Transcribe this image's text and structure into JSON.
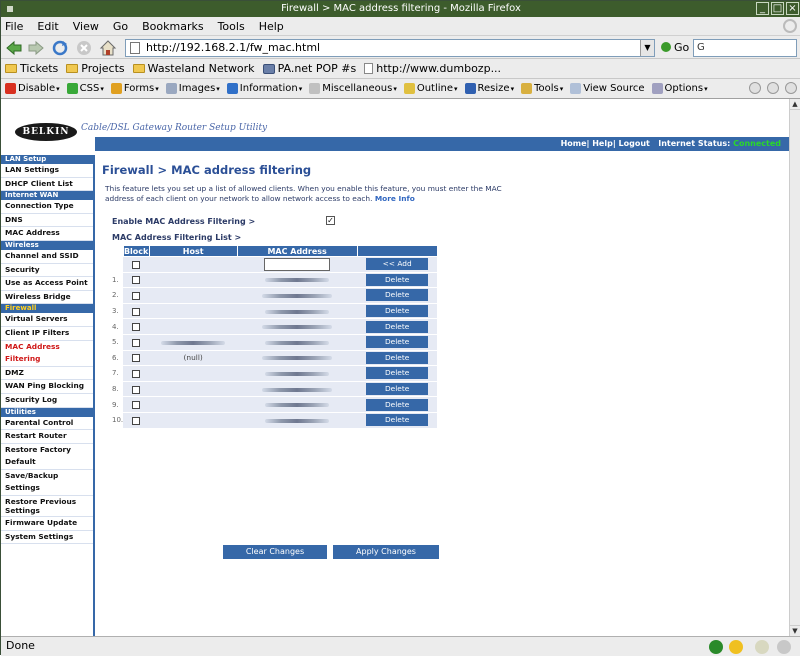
{
  "window": {
    "title": "Firewall > MAC address filtering - Mozilla Firefox"
  },
  "menu": {
    "file": "File",
    "edit": "Edit",
    "view": "View",
    "go": "Go",
    "bookmarks": "Bookmarks",
    "tools": "Tools",
    "help": "Help"
  },
  "toolbar": {
    "url": "http://192.168.2.1/fw_mac.html",
    "go_label": "Go",
    "search_value": "G"
  },
  "bookmarks": [
    {
      "label": "Tickets",
      "icon": "folder-icon"
    },
    {
      "label": "Projects",
      "icon": "folder-icon"
    },
    {
      "label": "Wasteland Network",
      "icon": "folder-icon"
    },
    {
      "label": "PA.net POP #s",
      "icon": "bookmark-icon"
    },
    {
      "label": "http://www.dumbozp...",
      "icon": "page-icon"
    }
  ],
  "devbar": [
    {
      "label": "Disable",
      "color": "#d83020"
    },
    {
      "label": "CSS",
      "color": "#38a838"
    },
    {
      "label": "Forms",
      "color": "#e0a020"
    },
    {
      "label": "Images",
      "color": "#9aa8c0"
    },
    {
      "label": "Information",
      "color": "#3070c8"
    },
    {
      "label": "Miscellaneous",
      "color": "#c0c0c0"
    },
    {
      "label": "Outline",
      "color": "#e0c040"
    },
    {
      "label": "Resize",
      "color": "#3060b0"
    },
    {
      "label": "Tools",
      "color": "#d8b040"
    },
    {
      "label": "View Source",
      "color": "#b0c0d8"
    },
    {
      "label": "Options",
      "color": "#a0a0c0"
    }
  ],
  "router": {
    "logo": "BELKIN",
    "tagline": "Cable/DSL Gateway Router Setup Utility",
    "toplinks": "Home| Help| Logout",
    "status_label": "Internet Status:",
    "status_value": "Connected"
  },
  "nav": [
    {
      "type": "header",
      "label": "LAN Setup"
    },
    {
      "type": "item",
      "label": "LAN Settings"
    },
    {
      "type": "item",
      "label": "DHCP Client List"
    },
    {
      "type": "header",
      "label": "Internet WAN"
    },
    {
      "type": "item",
      "label": "Connection Type"
    },
    {
      "type": "item",
      "label": "DNS"
    },
    {
      "type": "item",
      "label": "MAC Address"
    },
    {
      "type": "header",
      "label": "Wireless"
    },
    {
      "type": "item",
      "label": "Channel and SSID"
    },
    {
      "type": "item",
      "label": "Security"
    },
    {
      "type": "item",
      "label": "Use as Access Point"
    },
    {
      "type": "item",
      "label": "Wireless Bridge"
    },
    {
      "type": "header",
      "label": "Firewall",
      "variant": "fw"
    },
    {
      "type": "item",
      "label": "Virtual Servers"
    },
    {
      "type": "item",
      "label": "Client IP Filters"
    },
    {
      "type": "item",
      "label": "MAC Address Filtering",
      "active": true
    },
    {
      "type": "item",
      "label": "DMZ"
    },
    {
      "type": "item",
      "label": "WAN Ping Blocking"
    },
    {
      "type": "item",
      "label": "Security Log"
    },
    {
      "type": "header",
      "label": "Utilities"
    },
    {
      "type": "item",
      "label": "Parental Control"
    },
    {
      "type": "item",
      "label": "Restart Router"
    },
    {
      "type": "item",
      "label": "Restore Factory Default"
    },
    {
      "type": "item",
      "label": "Save/Backup Settings"
    },
    {
      "type": "item",
      "label": "Restore Previous Settings",
      "two": true
    },
    {
      "type": "item",
      "label": "Firmware Update"
    },
    {
      "type": "item",
      "label": "System Settings"
    }
  ],
  "page": {
    "title": "Firewall > MAC address filtering",
    "description": "This feature lets you set up a list of allowed clients. When you enable this feature, you must enter the MAC address of each client on your network to allow network access to each.",
    "more_info": "More Info",
    "enable_label": "Enable MAC Address Filtering >",
    "enable_checked": true,
    "list_label": "MAC Address Filtering List >"
  },
  "table": {
    "headers": {
      "block": "Block",
      "host": "Host",
      "mac": "MAC Address"
    },
    "add_label": "<< Add",
    "rows": [
      {
        "num": "1.",
        "host": "",
        "action": "Delete"
      },
      {
        "num": "2.",
        "host": "",
        "action": "Delete"
      },
      {
        "num": "3.",
        "host": "",
        "action": "Delete"
      },
      {
        "num": "4.",
        "host": "",
        "action": "Delete"
      },
      {
        "num": "5.",
        "host": "",
        "action": "Delete"
      },
      {
        "num": "6.",
        "host": "(null)",
        "action": "Delete"
      },
      {
        "num": "7.",
        "host": "",
        "action": "Delete"
      },
      {
        "num": "8.",
        "host": "",
        "action": "Delete"
      },
      {
        "num": "9.",
        "host": "",
        "action": "Delete"
      },
      {
        "num": "10.",
        "host": "",
        "action": "Delete"
      }
    ]
  },
  "buttons": {
    "clear": "Clear Changes",
    "apply": "Apply Changes"
  },
  "status": {
    "text": "Done"
  }
}
